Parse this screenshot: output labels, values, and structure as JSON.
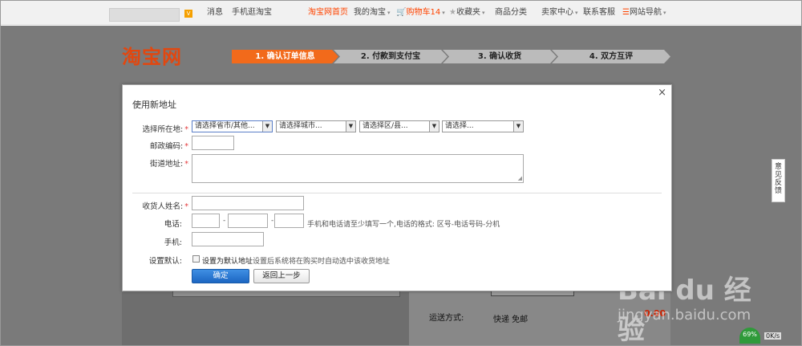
{
  "topbar": {
    "messages": "消息",
    "mobile": "手机逛淘宝",
    "home": "淘宝网首页",
    "my_taobao": "我的淘宝",
    "cart": "购物车14",
    "favorites": "收藏夹",
    "categories": "商品分类",
    "seller_center": "卖家中心",
    "contact": "联系客服",
    "site_nav": "网站导航"
  },
  "logo": "淘宝网",
  "steps": [
    "1. 确认订单信息",
    "2. 付款到支付宝",
    "3. 确认收货",
    "4. 双方互评"
  ],
  "modal": {
    "title": "使用新地址",
    "close": "×",
    "location_label": "选择所在地:",
    "selects": [
      "请选择省市/其他...",
      "请选择城市...",
      "请选择区/县...",
      "请选择..."
    ],
    "zip_label": "邮政编码:",
    "street_label": "街道地址:",
    "name_label": "收货人姓名:",
    "phone_label": "电话:",
    "phone_hint": "手机和电话请至少填写一个,电话的格式: 区号-电话号码-分机",
    "mobile_label": "手机:",
    "default_label": "设置默认:",
    "default_checkbox": "设置为默认地址",
    "default_hint": "设置后系统将在购买时自动选中该收货地址",
    "confirm": "确定",
    "back": "返回上一步",
    "required_mark": "*",
    "dash": "-"
  },
  "background": {
    "shipping_label": "运送方式:",
    "shipping_value": "快递 免邮",
    "price": "0.00"
  },
  "feedback": "意见反馈",
  "watermark": {
    "brand": "Bai du 经验",
    "url": "jingyan.baidu.com"
  },
  "speed": {
    "percent": "69%",
    "rate": "0K/s"
  }
}
